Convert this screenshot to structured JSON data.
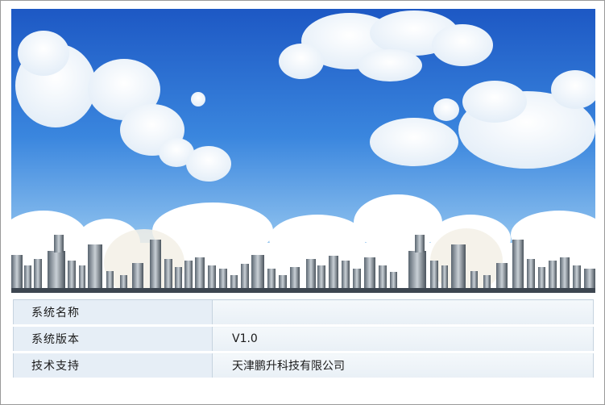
{
  "system_info": {
    "rows": [
      {
        "label": "系统名称",
        "value": ""
      },
      {
        "label": "系统版本",
        "value": "V1.0"
      },
      {
        "label": "技术支持",
        "value": "天津鹏升科技有限公司"
      }
    ]
  },
  "colors": {
    "sky_top": "#1f5fc8",
    "sky_bottom": "#9fcaf0",
    "label_bg": "#e6eef6",
    "value_bg": "#eef4f8",
    "border": "#c6d3df"
  },
  "banner": {
    "image": "sky-clouds-city-skyline"
  }
}
